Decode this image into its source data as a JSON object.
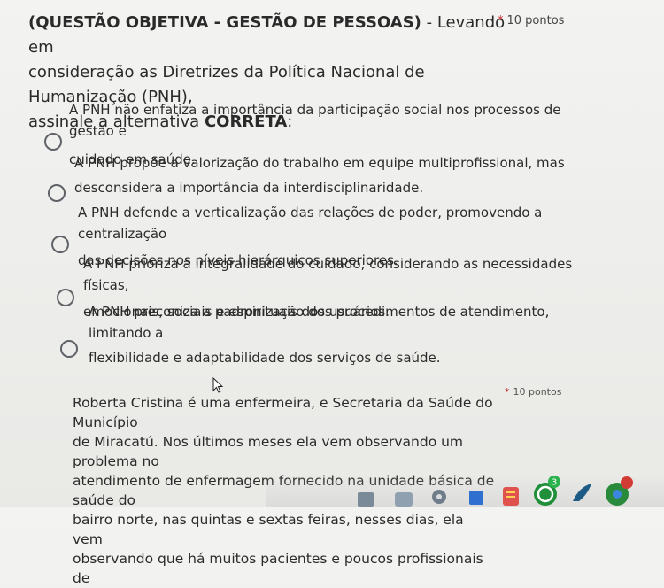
{
  "question1": {
    "title_bold": "(QUESTÃO OBJETIVA - GESTÃO DE PESSOAS)",
    "title_rest_line1": " - Levando em",
    "title_line2": "consideração as Diretrizes da Política Nacional de Humanização (PNH),",
    "title_line3_pre": "assinale a alternativa ",
    "title_line3_emph": "CORRETA",
    "title_line3_post": ":",
    "required_mark": "*",
    "points": "10 pontos",
    "options": [
      {
        "line1": "A PNH não enfatiza a importância da participação social nos processos de gestão e",
        "line2": "cuidado em saúde."
      },
      {
        "line1": "A PNH propõe a valorização do trabalho em equipe multiprofissional, mas",
        "line2": "desconsidera a importância da interdisciplinaridade."
      },
      {
        "line1": "A PNH defende a verticalização das relações de poder, promovendo a centralização",
        "line2": "das decisões nos níveis hierárquicos superiores."
      },
      {
        "line1": "A PNH prioriza a integralidade do cuidado, considerando as necessidades físicas,",
        "line2": "emocionais, sociais e espirituais dos usuários."
      },
      {
        "line1": "A PNH preconiza a padronização dos procedimentos de atendimento, limitando a",
        "line2": "flexibilidade e adaptabilidade dos serviços de saúde."
      }
    ]
  },
  "question2": {
    "lines": [
      "Roberta Cristina é uma enfermeira, e Secretaria da Saúde do Município",
      "de Miracatú. Nos últimos meses ela vem observando um problema no",
      "atendimento de enfermagem fornecido na unidade básica de saúde do",
      "bairro norte, nas quintas e sextas feiras, nesses dias, ela vem",
      "observando que há muitos pacientes e poucos profissionais de"
    ],
    "required_mark": "*",
    "points": "10 pontos"
  },
  "taskbar": {
    "badge_count": "3"
  }
}
